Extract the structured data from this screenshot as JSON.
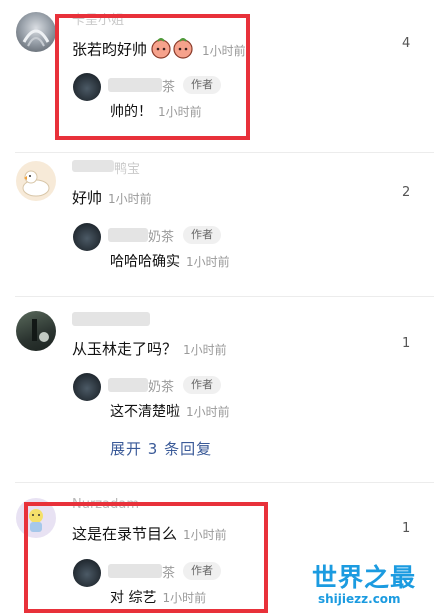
{
  "comments": [
    {
      "name": "卡呈小姐",
      "text": "张若昀好帅",
      "time": "1小时前",
      "count": "4",
      "reply": {
        "name": "茶",
        "badge": "作者",
        "text": "帅的！",
        "time": "1小时前"
      }
    },
    {
      "name": "鸭宝",
      "text": "好帅",
      "time": "1小时前",
      "count": "2",
      "reply": {
        "name": "奶茶",
        "badge": "作者",
        "text": "哈哈哈确实",
        "time": "1小时前"
      }
    },
    {
      "name": "",
      "text": "从玉林走了吗？",
      "time": "1小时前",
      "count": "1",
      "reply": {
        "name": "奶茶",
        "badge": "作者",
        "text": "这不清楚啦",
        "time": "1小时前"
      },
      "expand": "展开 3 条回复"
    },
    {
      "name": "Nurzadam",
      "text": "这是在录节目么",
      "time": "1小时前",
      "count": "1",
      "reply": {
        "name": "茶",
        "badge": "作者",
        "text": "对 综艺",
        "time": "1小时前"
      }
    }
  ],
  "watermark": {
    "title": "世界之最",
    "url": "shijiezz.com"
  },
  "colors": {
    "highlight": "#e8313a",
    "link": "#3a5a98",
    "watermark": "#1b9be0"
  }
}
